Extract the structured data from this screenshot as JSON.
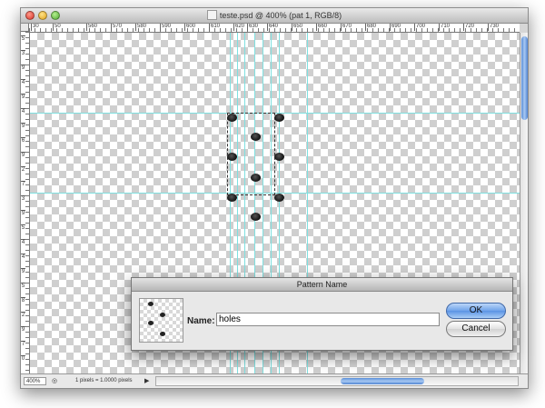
{
  "window": {
    "title": "teste.psd @ 400% (pat 1, RGB/8)"
  },
  "ruler": {
    "h_labels": [
      "30",
      "50",
      "560",
      "570",
      "580",
      "590",
      "600",
      "610",
      "620",
      "630",
      "640",
      "650",
      "660",
      "670",
      "680",
      "690",
      "700",
      "710",
      "720",
      "730",
      "740",
      "750",
      "760",
      "770"
    ],
    "v_labels": [
      "5",
      "3",
      "9",
      "4",
      "9",
      "4",
      "9",
      "6",
      "9",
      "2",
      "7",
      "3",
      "9",
      "5",
      "4",
      "4",
      "9",
      "5",
      "8",
      "2",
      "9",
      "7",
      "0"
    ]
  },
  "status": {
    "zoom": "400%",
    "info": "1 pixels = 1.0000 pixels"
  },
  "dialog": {
    "title": "Pattern Name",
    "name_label": "Name:",
    "name_value": "holes",
    "ok_label": "OK",
    "cancel_label": "Cancel"
  }
}
